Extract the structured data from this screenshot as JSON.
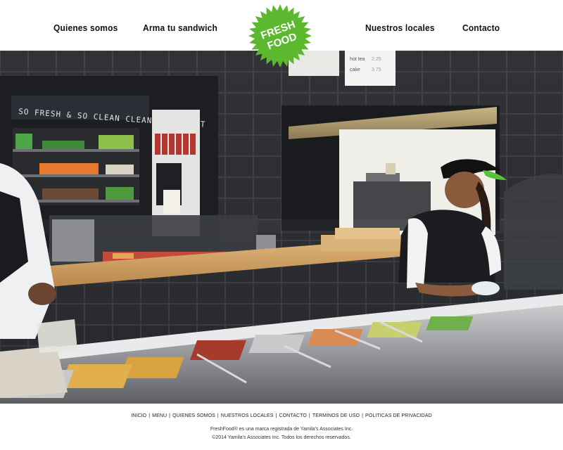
{
  "nav": {
    "left": [
      {
        "label": "Quienes somos"
      },
      {
        "label": "Arma tu sandwich"
      }
    ],
    "right": [
      {
        "label": "Nuestros locales"
      },
      {
        "label": "Contacto"
      }
    ]
  },
  "logo": {
    "line1": "FRESH",
    "line2": "FOOD",
    "color": "#5cb82e"
  },
  "hero": {
    "wall_sign": "SO FRESH & SO CLEAN CLEAN - OUTKAST",
    "menu_board_lines": [
      "hot tea",
      "cake"
    ],
    "menu_board_prices": [
      "2.25",
      "3.75"
    ]
  },
  "footer": {
    "links": [
      {
        "label": "INICIO"
      },
      {
        "label": "MENU"
      },
      {
        "label": "QUIENES SOMOS"
      },
      {
        "label": "NUESTROS LOCALES"
      },
      {
        "label": "CONTACTO"
      },
      {
        "label": "TERMINOS DE USO"
      },
      {
        "label": "POLITICAS DE PRIVACIDAD"
      }
    ],
    "trademark": "FreshFood® es una marca registrada de Yamila's Associates Inc.",
    "copyright": "©2014 Yamila's Associates Inc. Todos los derechos reservados."
  }
}
